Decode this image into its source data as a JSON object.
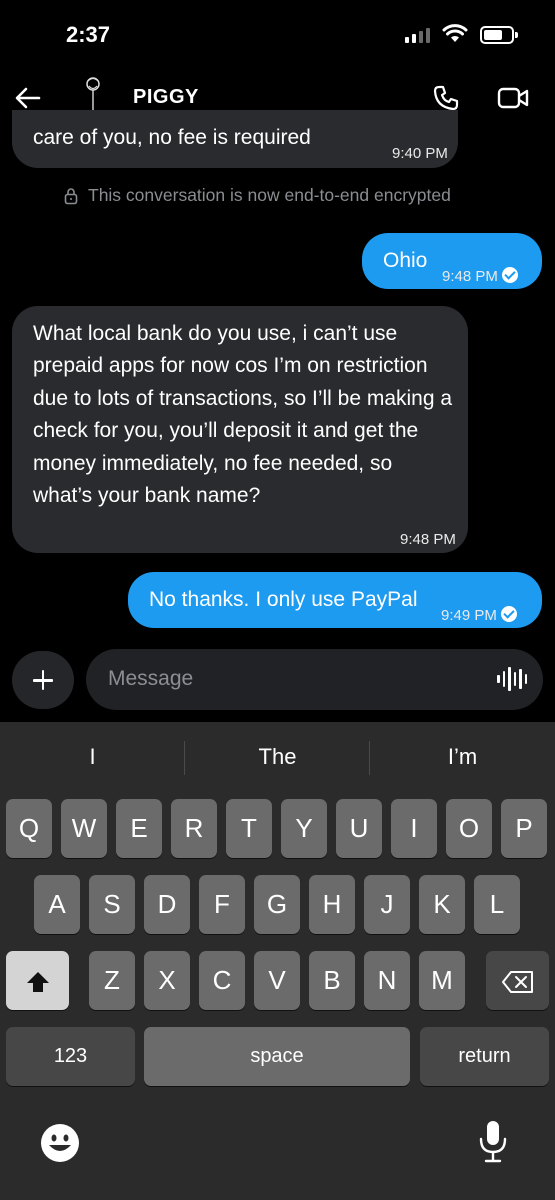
{
  "status_bar": {
    "time": "2:37"
  },
  "header": {
    "contact_name": "PIGGY"
  },
  "messages": [
    {
      "direction": "incoming",
      "text": "care of you, no fee is required",
      "time": "9:40 PM"
    },
    {
      "direction": "outgoing",
      "text": "Ohio",
      "time": "9:48 PM"
    },
    {
      "direction": "incoming",
      "text": "What local bank do you use, i can’t use prepaid apps for now cos I’m on restriction due to lots of transactions, so I’ll be making a check for you, you’ll deposit it and get the money immediately, no fee needed, so what’s your bank name?",
      "time": "9:48 PM"
    },
    {
      "direction": "outgoing",
      "text": "No thanks. I only use PayPal",
      "time": "9:49 PM"
    }
  ],
  "encryption_notice": "This conversation is now end-to-end encrypted",
  "composer": {
    "placeholder": "Message"
  },
  "keyboard": {
    "suggestions": [
      "I",
      "The",
      "I’m"
    ],
    "row1": [
      "Q",
      "W",
      "E",
      "R",
      "T",
      "Y",
      "U",
      "I",
      "O",
      "P"
    ],
    "row2": [
      "A",
      "S",
      "D",
      "F",
      "G",
      "H",
      "J",
      "K",
      "L"
    ],
    "row3": [
      "Z",
      "X",
      "C",
      "V",
      "B",
      "N",
      "M"
    ],
    "numbers_label": "123",
    "space_label": "space",
    "return_label": "return"
  },
  "colors": {
    "outgoing_bubble": "#1d9bf0",
    "incoming_bubble": "#2a2b2f",
    "background": "#000000"
  },
  "icons": [
    "back-arrow-icon",
    "phone-icon",
    "video-icon",
    "lock-icon",
    "verified-check-icon",
    "plus-icon",
    "voice-waveform-icon",
    "shift-icon",
    "delete-icon",
    "emoji-icon",
    "microphone-icon"
  ]
}
